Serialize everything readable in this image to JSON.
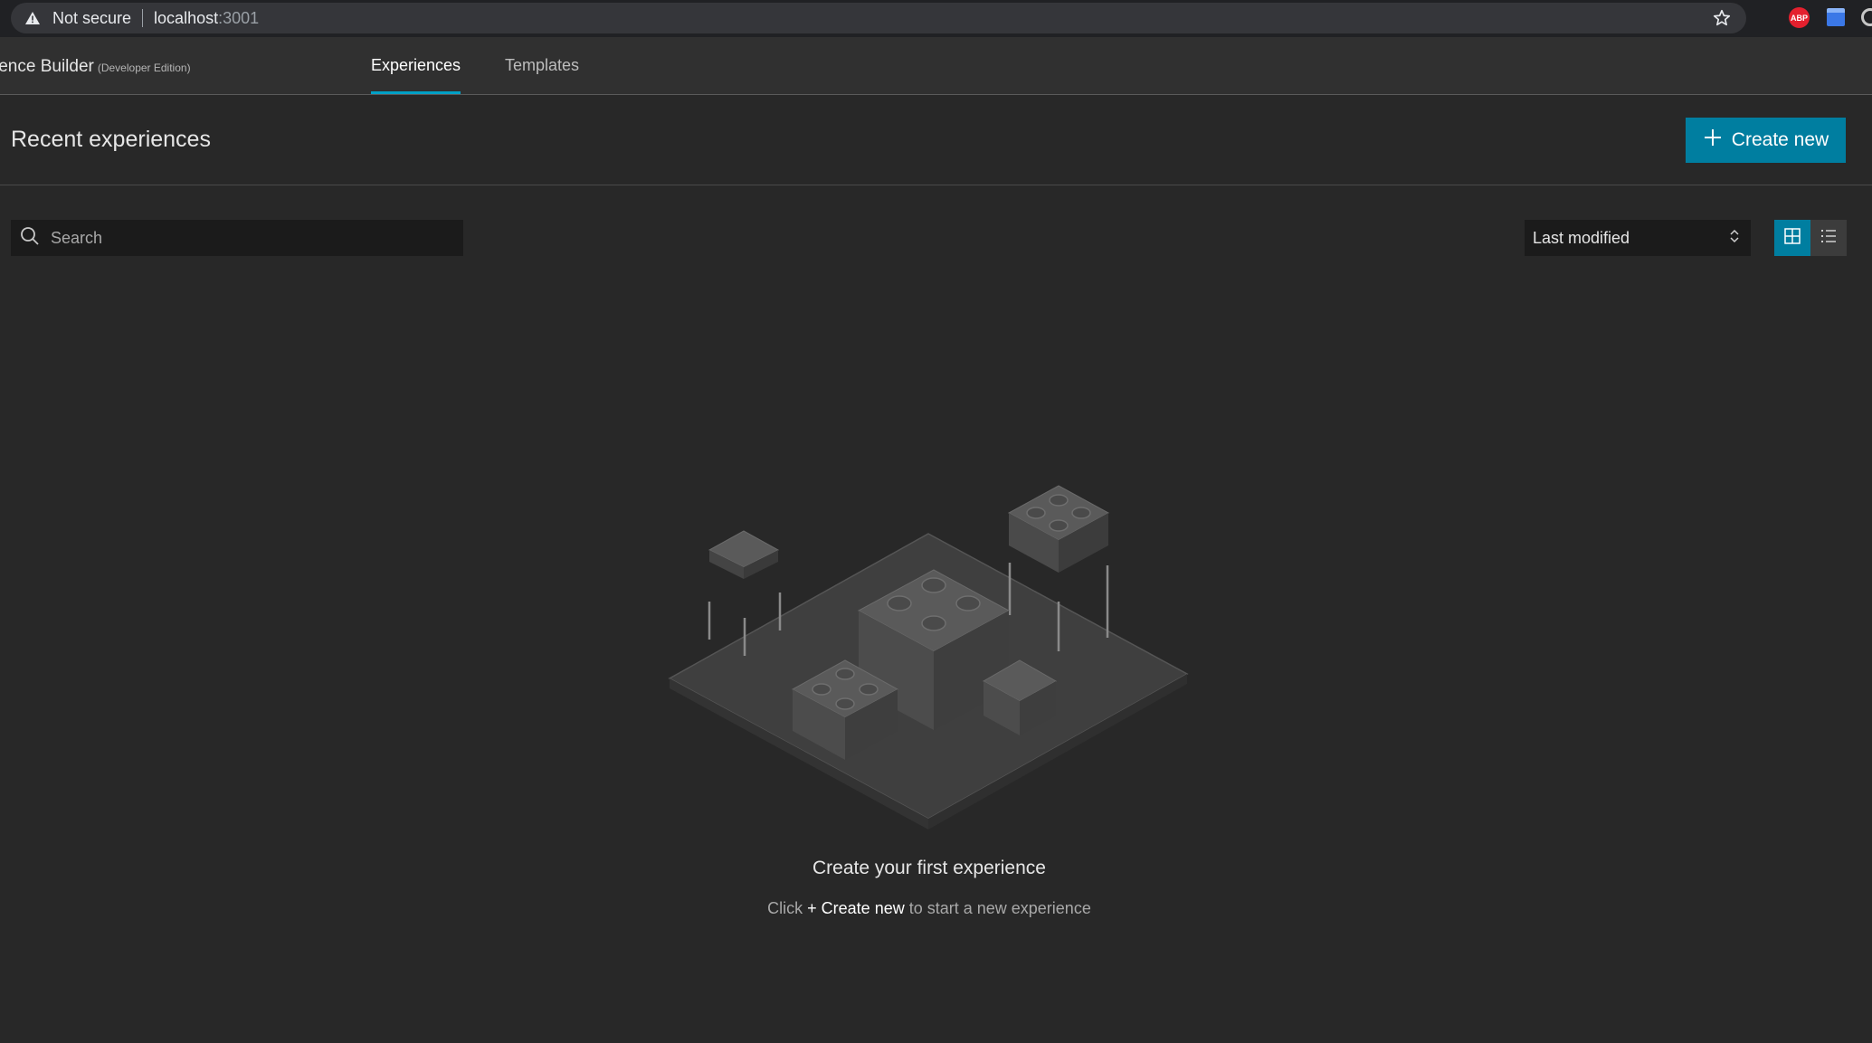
{
  "browser": {
    "security_label": "Not secure",
    "url_host": "localhost",
    "url_port": ":3001",
    "extensions": {
      "abp_label": "ABP"
    }
  },
  "app": {
    "title": "ience Builder",
    "edition": "(Developer Edition)",
    "tabs": [
      {
        "label": "Experiences",
        "active": true
      },
      {
        "label": "Templates",
        "active": false
      }
    ]
  },
  "page": {
    "title": "Recent experiences",
    "create_button_label": "Create new",
    "search": {
      "placeholder": "Search",
      "value": ""
    },
    "sort": {
      "selected": "Last modified"
    },
    "view_modes": {
      "selected": "grid"
    }
  },
  "empty_state": {
    "title": "Create your first experience",
    "hint_prefix": "Click ",
    "hint_action": "+ Create new",
    "hint_suffix": " to start a new experience"
  },
  "colors": {
    "accent": "#007ea0",
    "tab_indicator": "#00a0c6",
    "background": "#282828",
    "header": "#303030"
  }
}
